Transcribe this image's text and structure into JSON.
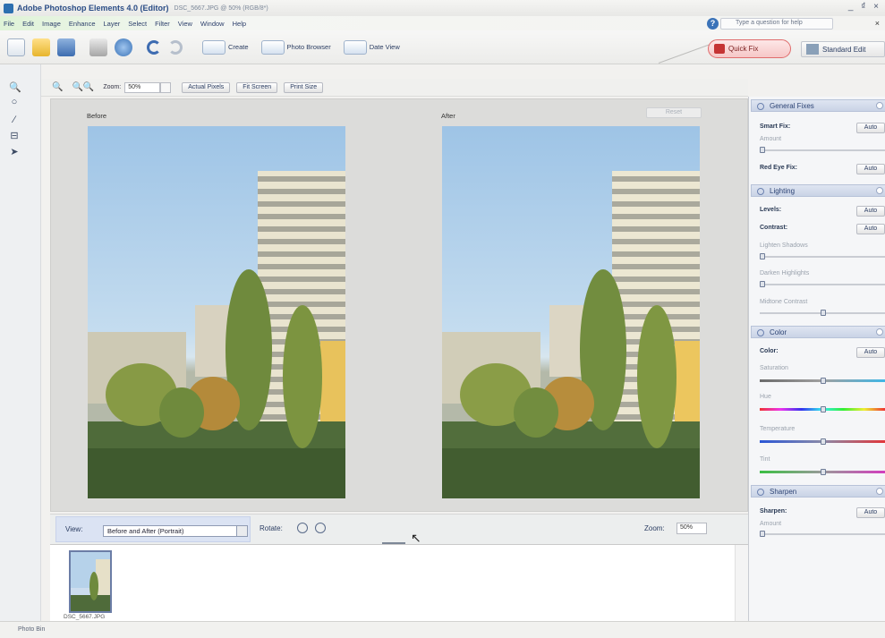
{
  "window": {
    "app_title": "Adobe Photoshop Elements 4.0 (Editor)",
    "file_info": "DSC_5667.JPG @ 50% (RGB/8*)",
    "controls": "_ ₫ ×"
  },
  "menu": {
    "items": [
      "File",
      "Edit",
      "Image",
      "Enhance",
      "Layer",
      "Select",
      "Filter",
      "View",
      "Window",
      "Help"
    ],
    "help_placeholder": "Type a question for help",
    "close": "×"
  },
  "toolbar": {
    "create_label": "Create",
    "photo_browser_label": "Photo Browser",
    "date_view_label": "Date View",
    "quick_fix_label": "Quick Fix",
    "standard_edit_label": "Standard Edit"
  },
  "options": {
    "zoom_label": "Zoom:",
    "zoom_value": "50%",
    "actual_pixels": "Actual Pixels",
    "fit_screen": "Fit Screen",
    "print_size": "Print Size"
  },
  "canvas": {
    "before_label": "Before",
    "after_label": "After",
    "reset_label": "Reset"
  },
  "viewbar": {
    "view_label": "View:",
    "view_value": "Before and After (Portrait)",
    "rotate_label": "Rotate:",
    "zoom_label": "Zoom:",
    "zoom_value": "50%"
  },
  "bin": {
    "thumb_name": "DSC_5667.JPG"
  },
  "panel": {
    "general_fixes": "General Fixes",
    "smart_fix": "Smart Fix:",
    "amount": "Amount",
    "red_eye_fix": "Red Eye Fix:",
    "lighting": "Lighting",
    "levels": "Levels:",
    "contrast": "Contrast:",
    "lighten_shadows": "Lighten Shadows",
    "darken_highlights": "Darken Highlights",
    "midtone_contrast": "Midtone Contrast",
    "color": "Color",
    "color_row": "Color:",
    "saturation": "Saturation",
    "hue": "Hue",
    "temperature": "Temperature",
    "tint": "Tint",
    "sharpen": "Sharpen",
    "sharpen_row": "Sharpen:",
    "sharpen_amount": "Amount",
    "auto_label": "Auto"
  },
  "status": {
    "text": "Photo Bin"
  },
  "colors": {
    "quick_fix_accent": "#e06d6d",
    "panel_header": "#c9d3e6"
  }
}
